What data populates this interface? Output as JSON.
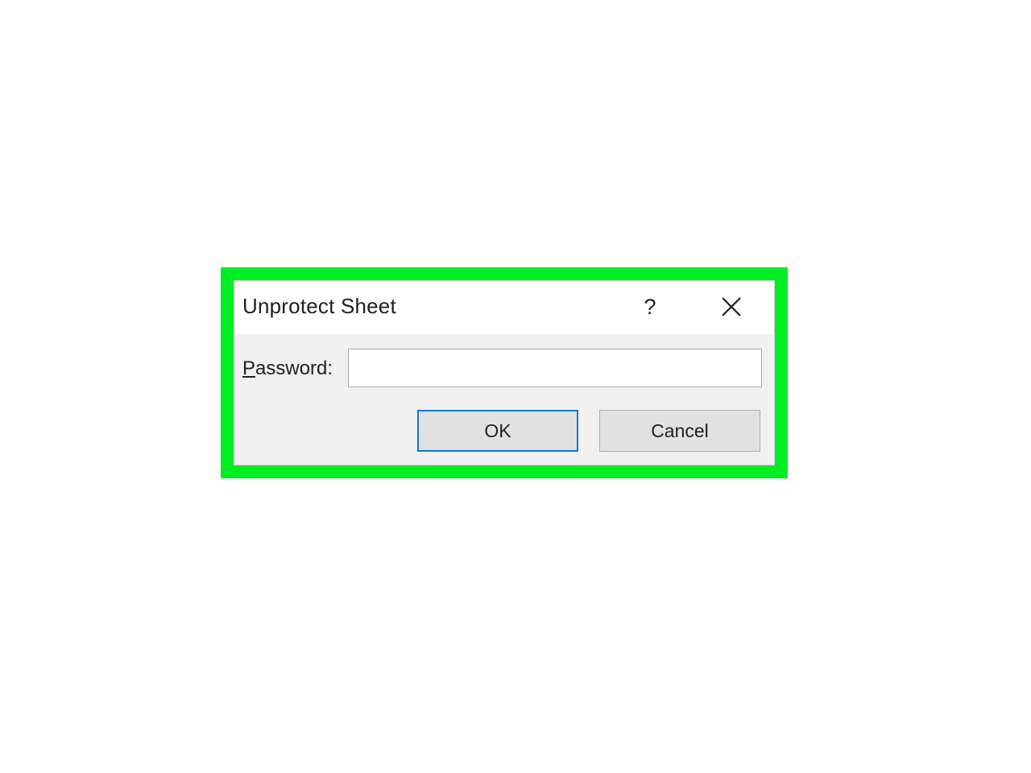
{
  "dialog": {
    "title": "Unprotect Sheet",
    "help_label": "?",
    "close_icon": "close-icon",
    "password": {
      "label_mnemonic": "P",
      "label_rest": "assword:",
      "value": "",
      "placeholder": ""
    },
    "buttons": {
      "ok_label": "OK",
      "cancel_label": "Cancel"
    }
  },
  "colors": {
    "highlight": "#00ee22",
    "default_button_border": "#0a78d7",
    "dialog_body": "#f0f0f0"
  }
}
